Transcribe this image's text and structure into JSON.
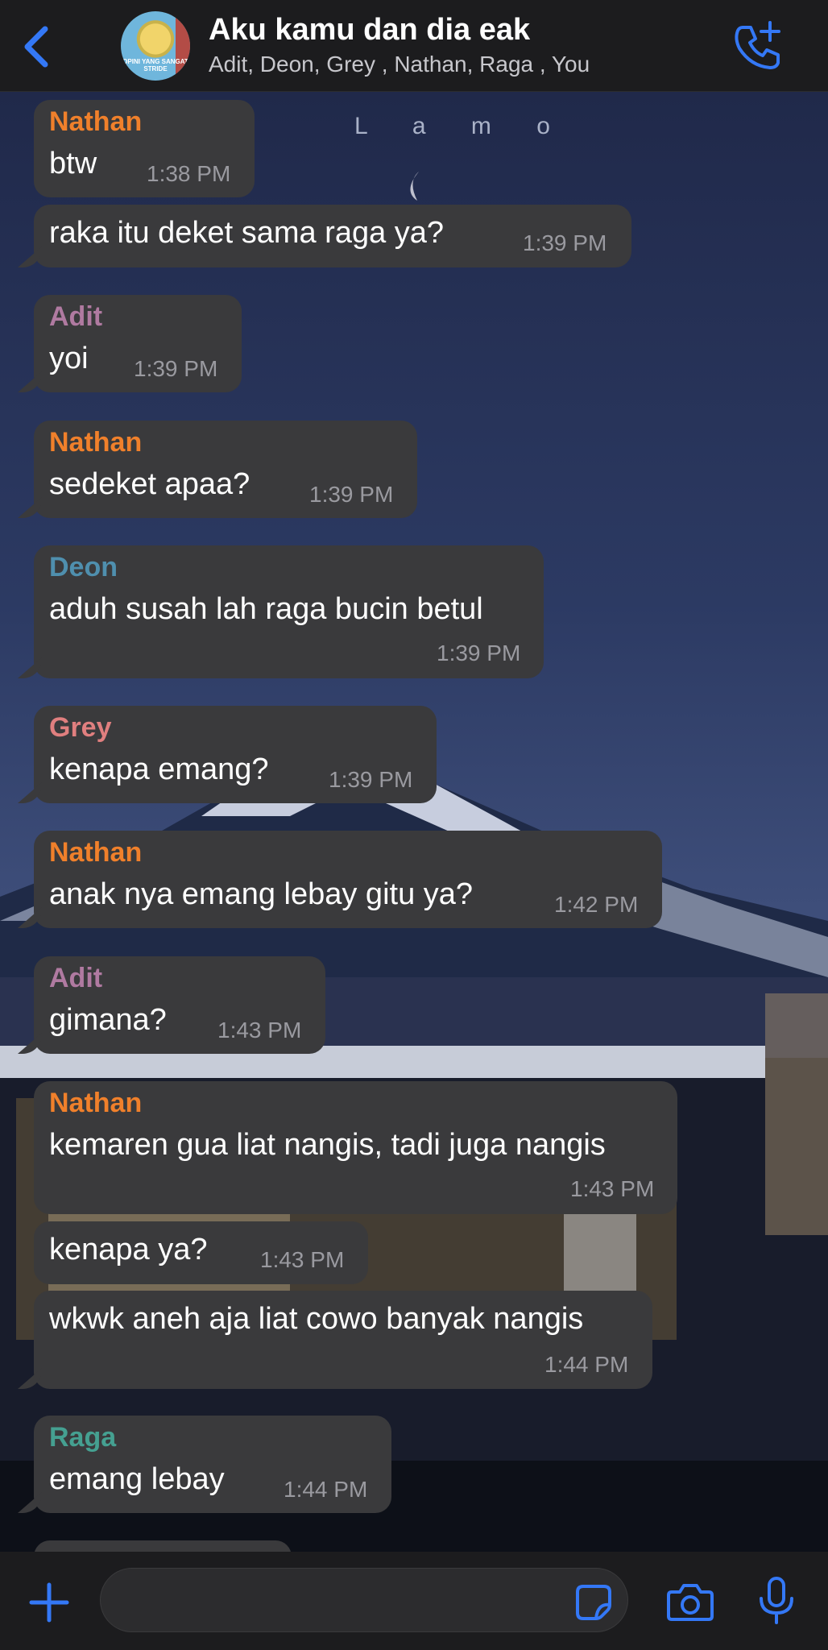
{
  "header": {
    "title": "Aku kamu dan dia eak",
    "members": "Adit, Deon, Grey , Nathan, Raga , You",
    "avatar_caption": "OPINI YANG SANGAT STRIDE",
    "back_icon": "chevron-left-icon",
    "call_icon": "phone-add-icon"
  },
  "watermark": "L a m o",
  "colors": {
    "accent": "#3478f6",
    "bubble": "#3a3a3c",
    "nathan": "#f0802b",
    "adit": "#b07aa1",
    "deon": "#4f8fae",
    "grey": "#e07f7f",
    "raga": "#45a091"
  },
  "messages": [
    {
      "sender": "Nathan",
      "text": "btw",
      "time": "1:38 PM"
    },
    {
      "sender": "",
      "text": "raka itu deket sama raga ya?",
      "time": "1:39 PM"
    },
    {
      "sender": "Adit",
      "text": "yoi",
      "time": "1:39 PM"
    },
    {
      "sender": "Nathan",
      "text": "sedeket apaa?",
      "time": "1:39 PM"
    },
    {
      "sender": "Deon",
      "text": "aduh susah lah raga bucin betul",
      "time": "1:39 PM"
    },
    {
      "sender": "Grey",
      "text": "kenapa emang?",
      "time": "1:39 PM"
    },
    {
      "sender": "Nathan",
      "text": "anak nya emang lebay gitu ya?",
      "time": "1:42 PM"
    },
    {
      "sender": "Adit",
      "text": "gimana?",
      "time": "1:43 PM"
    },
    {
      "sender": "Nathan",
      "text": "kemaren gua liat nangis, tadi juga nangis",
      "time": "1:43 PM"
    },
    {
      "sender": "",
      "text": "kenapa ya?",
      "time": "1:43 PM"
    },
    {
      "sender": "",
      "text": "wkwk aneh aja liat cowo banyak nangis",
      "time": "1:44 PM"
    },
    {
      "sender": "Raga",
      "text": "emang lebay",
      "time": "1:44 PM"
    }
  ],
  "composer": {
    "plus_icon": "plus-icon",
    "sticker_icon": "sticker-icon",
    "camera_icon": "camera-icon",
    "mic_icon": "microphone-icon"
  }
}
